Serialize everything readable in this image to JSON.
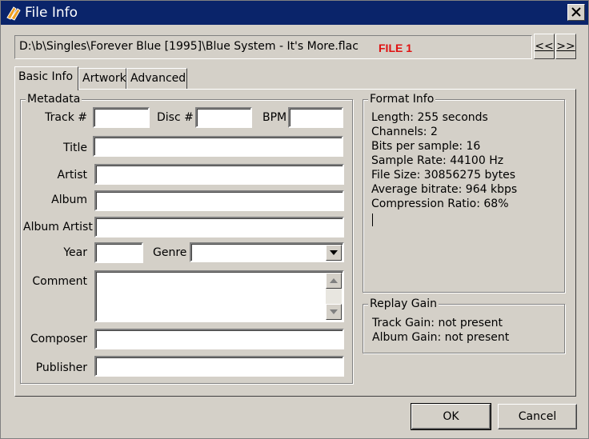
{
  "window": {
    "title": "File Info",
    "close_label": "close"
  },
  "path_bar": {
    "path": "D:\\b\\Singles\\Forever Blue [1995]\\Blue System - It's More.flac",
    "file_label": "FILE 1",
    "file_label_color": "#e01010"
  },
  "nav": {
    "prev_label": "<<",
    "next_label": ">>"
  },
  "tabs": [
    {
      "label": "Basic Info",
      "active": true
    },
    {
      "label": "Artwork",
      "active": false
    },
    {
      "label": "Advanced",
      "active": false
    }
  ],
  "metadata": {
    "group_title": "Metadata",
    "track_label": "Track #",
    "disc_label": "Disc #",
    "bpm_label": "BPM",
    "title_label": "Title",
    "artist_label": "Artist",
    "album_label": "Album",
    "album_artist_label": "Album Artist",
    "year_label": "Year",
    "genre_label": "Genre",
    "comment_label": "Comment",
    "composer_label": "Composer",
    "publisher_label": "Publisher",
    "values": {
      "track": "",
      "disc": "",
      "bpm": "",
      "title": "",
      "artist": "",
      "album": "",
      "album_artist": "",
      "year": "",
      "genre": "",
      "comment": "",
      "composer": "",
      "publisher": ""
    }
  },
  "format_info": {
    "group_title": "Format Info",
    "lines": [
      "Length: 255 seconds",
      "Channels: 2",
      "Bits per sample: 16",
      "Sample Rate: 44100 Hz",
      "File Size: 30856275 bytes",
      "Average bitrate: 964 kbps",
      "Compression Ratio: 68%"
    ]
  },
  "replay_gain": {
    "group_title": "Replay Gain",
    "lines": [
      "Track Gain: not present",
      "Album Gain: not present"
    ]
  },
  "buttons": {
    "ok": "OK",
    "cancel": "Cancel"
  },
  "colors": {
    "titlebar": "#0a246a",
    "dialog": "#d4d0c8"
  }
}
